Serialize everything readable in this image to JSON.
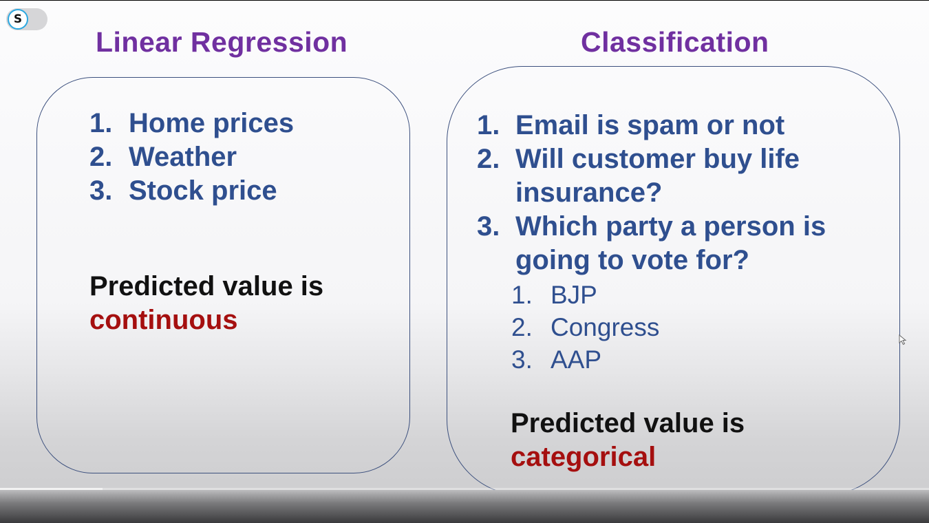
{
  "logo": {
    "letter": "S"
  },
  "left_panel": {
    "title": "Linear Regression",
    "items": [
      {
        "num": "1.",
        "text": "Home prices"
      },
      {
        "num": "2.",
        "text": "Weather"
      },
      {
        "num": "3.",
        "text": "Stock price"
      }
    ],
    "predicted_prefix": "Predicted value is",
    "predicted_value": "continuous"
  },
  "right_panel": {
    "title": "Classification",
    "items": [
      {
        "num": "1.",
        "text": "Email is spam or not"
      },
      {
        "num": "2.",
        "text": "Will customer buy life insurance?"
      },
      {
        "num": "3.",
        "text": "Which party a person is going to vote for?"
      }
    ],
    "subitems": [
      {
        "num": "1.",
        "text": "BJP"
      },
      {
        "num": "2.",
        "text": "Congress"
      },
      {
        "num": "3.",
        "text": "AAP"
      }
    ],
    "predicted_prefix": "Predicted value is",
    "predicted_value": "categorical"
  },
  "player": {
    "progress": 0.11
  },
  "colors": {
    "title": "#7030a0",
    "list_text": "#2f4f8f",
    "highlight": "#a50f0f",
    "box_border": "#3b4f7d"
  }
}
